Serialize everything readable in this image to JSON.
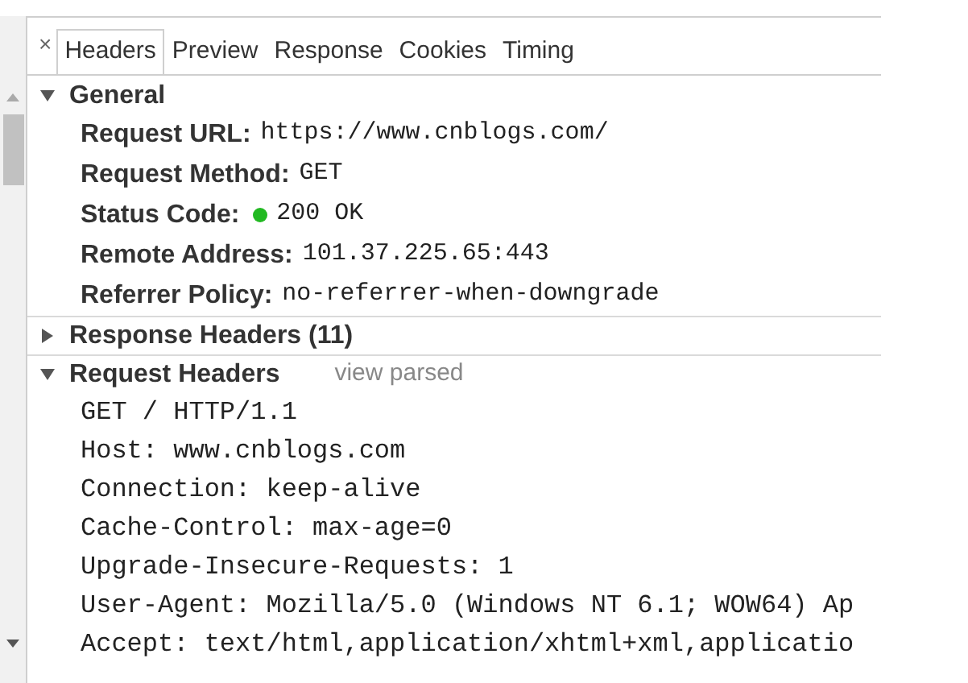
{
  "close_button": "×",
  "tabs": [
    {
      "label": "Headers",
      "selected": true
    },
    {
      "label": "Preview",
      "selected": false
    },
    {
      "label": "Response",
      "selected": false
    },
    {
      "label": "Cookies",
      "selected": false
    },
    {
      "label": "Timing",
      "selected": false
    }
  ],
  "sections": [
    {
      "title": "General",
      "expanded": true,
      "kind": "fields",
      "fields": [
        {
          "label": "Request URL:",
          "value": "https://www.cnblogs.com/"
        },
        {
          "label": "Request Method:",
          "value": "GET"
        },
        {
          "label": "Status Code:",
          "value": "200 OK",
          "color": "#22b922"
        },
        {
          "label": "Remote Address:",
          "value": "101.37.225.65:443"
        },
        {
          "label": "Referrer Policy:",
          "value": "no-referrer-when-downgrade"
        }
      ]
    },
    {
      "title": "Response Headers (11)",
      "expanded": false
    },
    {
      "title": "Request Headers",
      "expanded": true,
      "kind": "source",
      "link": "view parsed",
      "lines": [
        "GET / HTTP/1.1",
        "Host: www.cnblogs.com",
        "Connection: keep-alive",
        "Cache-Control: max-age=0",
        "Upgrade-Insecure-Requests: 1",
        "User-Agent: Mozilla/5.0 (Windows NT 6.1; WOW64) Ap",
        "Accept: text/html,application/xhtml+xml,applicatio"
      ]
    }
  ]
}
